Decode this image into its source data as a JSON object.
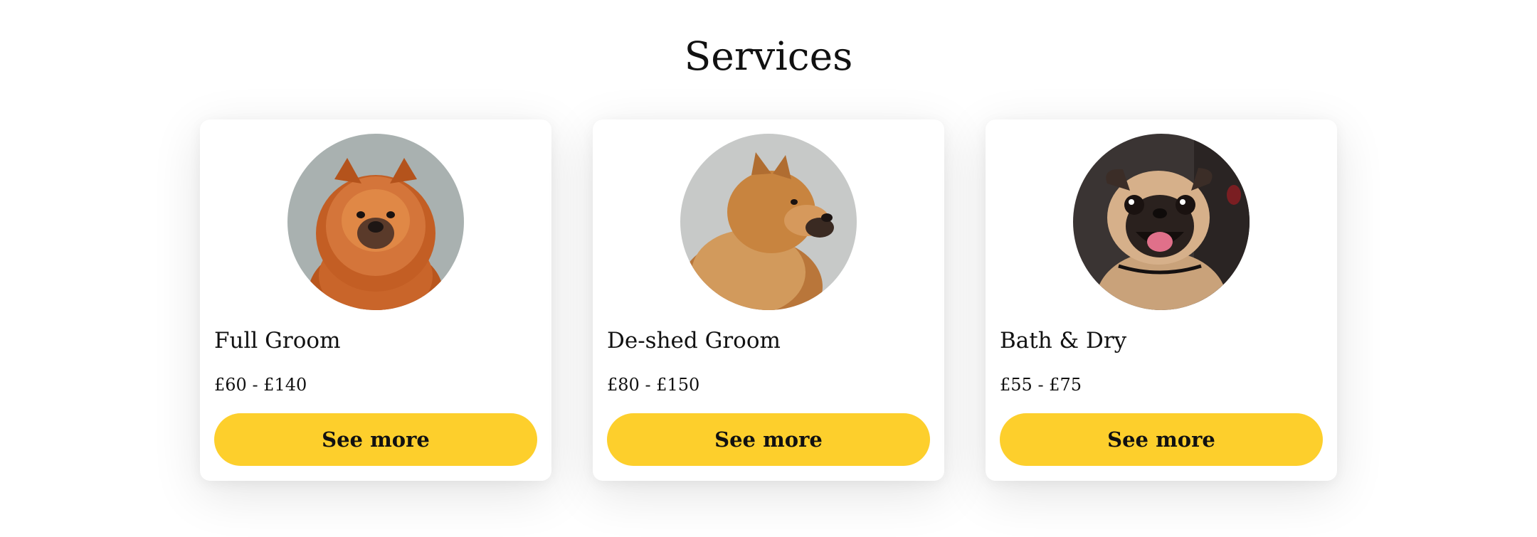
{
  "section": {
    "title": "Services"
  },
  "colors": {
    "accent": "#fdcf2c",
    "card_background": "#ffffff",
    "text": "#111111"
  },
  "services": [
    {
      "name": "Full Groom",
      "price": "£60 - £140",
      "button_label": "See more",
      "image": "chow-chow-front-photo"
    },
    {
      "name": "De-shed Groom",
      "price": "£80 - £150",
      "button_label": "See more",
      "image": "chow-chow-profile-photo"
    },
    {
      "name": "Bath & Dry",
      "price": "£55 - £75",
      "button_label": "See more",
      "image": "pug-photo"
    }
  ]
}
